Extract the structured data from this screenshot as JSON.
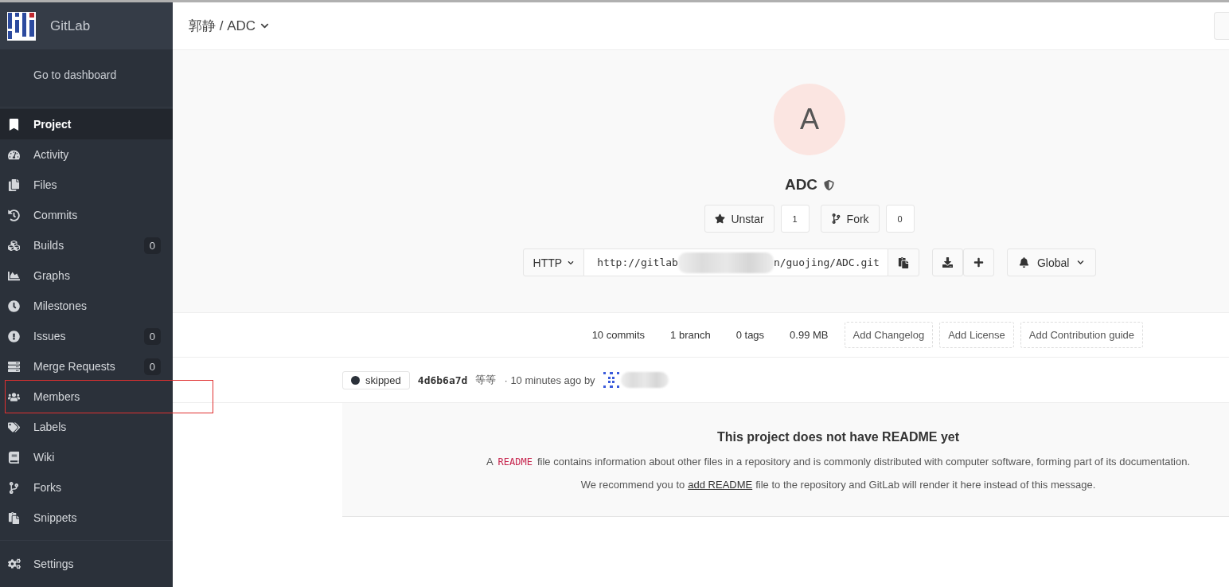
{
  "sidebar": {
    "brand": "GitLab",
    "dashboard_link": "Go to dashboard",
    "items": [
      {
        "label": "Project",
        "selected": true,
        "highlighted": false
      },
      {
        "label": "Activity",
        "selected": false,
        "highlighted": false
      },
      {
        "label": "Files",
        "selected": false,
        "highlighted": false
      },
      {
        "label": "Commits",
        "selected": false,
        "highlighted": false
      },
      {
        "label": "Builds",
        "selected": false,
        "highlighted": false,
        "count": "0"
      },
      {
        "label": "Graphs",
        "selected": false,
        "highlighted": false
      },
      {
        "label": "Milestones",
        "selected": false,
        "highlighted": false
      },
      {
        "label": "Issues",
        "selected": false,
        "highlighted": false,
        "count": "0"
      },
      {
        "label": "Merge Requests",
        "selected": false,
        "highlighted": false,
        "count": "0"
      },
      {
        "label": "Members",
        "selected": false,
        "highlighted": true
      },
      {
        "label": "Labels",
        "selected": false,
        "highlighted": false
      },
      {
        "label": "Wiki",
        "selected": false,
        "highlighted": false
      },
      {
        "label": "Forks",
        "selected": false,
        "highlighted": false
      },
      {
        "label": "Snippets",
        "selected": false,
        "highlighted": false
      }
    ],
    "settings": "Settings"
  },
  "header": {
    "breadcrumb": "郭静 / ADC"
  },
  "project": {
    "avatar_letter": "A",
    "name": "ADC",
    "star_button": "Unstar",
    "star_count": "1",
    "fork_button": "Fork",
    "fork_count": "0",
    "clone_protocol": "HTTP",
    "clone_url_start": "http://gitlab",
    "clone_url_end": "n/guojing/ADC.git",
    "notification": "Global"
  },
  "stats": [
    {
      "text": "10 commits",
      "kind": "stat"
    },
    {
      "text": "1 branch",
      "kind": "stat"
    },
    {
      "text": "0 tags",
      "kind": "stat"
    },
    {
      "text": "0.99 MB",
      "kind": "stat"
    },
    {
      "text": "Add Changelog",
      "kind": "action"
    },
    {
      "text": "Add License",
      "kind": "action"
    },
    {
      "text": "Add Contribution guide",
      "kind": "action"
    }
  ],
  "last_commit": {
    "status": "skipped",
    "sha": "4d6b6a7d",
    "message": "等等",
    "time": "· 10 minutes ago by"
  },
  "readme": {
    "title": "This project does not have README yet",
    "line1_start": "A",
    "line1_code": "README",
    "line1_end": "file contains information about other files in a repository and is commonly distributed with computer software, forming part of its documentation.",
    "line2_start": "We recommend you to",
    "line2_link": "add README",
    "line2_end": "file to the repository and GitLab will render it here instead of this message."
  }
}
